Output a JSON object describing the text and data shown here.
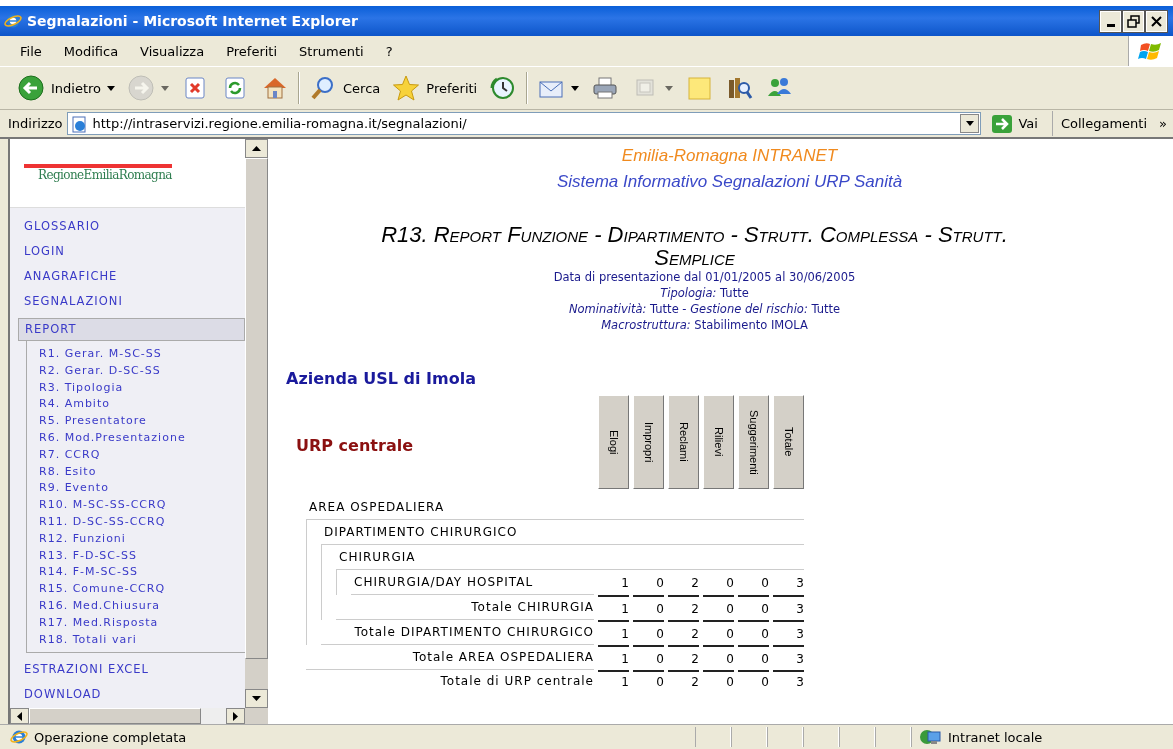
{
  "window": {
    "title": "Segnalazioni - Microsoft Internet Explorer"
  },
  "menu": [
    "File",
    "Modifica",
    "Visualizza",
    "Preferiti",
    "Strumenti",
    "?"
  ],
  "toolbar": {
    "groups": [
      [
        {
          "kind": "back",
          "label": "Indietro",
          "menu": true,
          "disabled": false
        },
        {
          "kind": "forward",
          "menu": true,
          "disabled": true
        },
        {
          "kind": "stop",
          "menu": false,
          "disabled": false
        },
        {
          "kind": "refresh",
          "menu": false,
          "disabled": false
        },
        {
          "kind": "home",
          "menu": false,
          "disabled": false
        }
      ],
      [
        {
          "kind": "search",
          "label": "Cerca",
          "menu": false,
          "disabled": false
        },
        {
          "kind": "favorites",
          "label": "Preferiti",
          "menu": false,
          "disabled": false
        },
        {
          "kind": "history",
          "menu": false,
          "disabled": false
        }
      ],
      [
        {
          "kind": "mail",
          "menu": true,
          "disabled": false
        },
        {
          "kind": "print",
          "menu": false,
          "disabled": false
        },
        {
          "kind": "edit",
          "menu": true,
          "disabled": true
        },
        {
          "kind": "notes",
          "menu": false,
          "disabled": false
        },
        {
          "kind": "research",
          "menu": false,
          "disabled": false
        },
        {
          "kind": "messenger",
          "menu": false,
          "disabled": false
        }
      ]
    ]
  },
  "address": {
    "label": "Indirizzo",
    "url": "http://intraservizi.regione.emilia-romagna.it/segnalazioni/",
    "go": "Vai",
    "links": "Collegamenti",
    "more": "»"
  },
  "sidebar": {
    "logo": "RegioneEmiliaRomagna",
    "items": [
      {
        "label": "GLOSSARIO",
        "selected": false
      },
      {
        "label": "LOGIN",
        "selected": false
      },
      {
        "label": "ANAGRAFICHE",
        "selected": false
      },
      {
        "label": "SEGNALAZIONI",
        "selected": false
      },
      {
        "label": "REPORT",
        "selected": true,
        "children": [
          {
            "label": "R1. Gerar. M-SC-SS",
            "selected": false
          },
          {
            "label": "R2. Gerar. D-SC-SS",
            "selected": false
          },
          {
            "label": "R3. Tipologia",
            "selected": false
          },
          {
            "label": "R4. Ambito",
            "selected": false
          },
          {
            "label": "R5. Presentatore",
            "selected": false
          },
          {
            "label": "R6. Mod.Presentazione",
            "selected": false
          },
          {
            "label": "R7. CCRQ",
            "selected": false
          },
          {
            "label": "R8. Esito",
            "selected": false
          },
          {
            "label": "R9. Evento",
            "selected": false
          },
          {
            "label": "R10. M-SC-SS-CCRQ",
            "selected": false
          },
          {
            "label": "R11. D-SC-SS-CCRQ",
            "selected": false
          },
          {
            "label": "R12. Funzioni",
            "selected": false
          },
          {
            "label": "R13. F-D-SC-SS",
            "selected": false
          },
          {
            "label": "R14. F-M-SC-SS",
            "selected": false
          },
          {
            "label": "R15. Comune-CCRQ",
            "selected": false
          },
          {
            "label": "R16. Med.Chiusura",
            "selected": false
          },
          {
            "label": "R17. Med.Risposta",
            "selected": false
          },
          {
            "label": "R18. Totali vari",
            "selected": false
          }
        ]
      },
      {
        "label": "ESTRAZIONI EXCEL",
        "selected": false
      },
      {
        "label": "DOWNLOAD",
        "selected": false
      }
    ]
  },
  "header": {
    "brand": "Emilia-Romagna INTRANET",
    "system": "Sistema Informativo Segnalazioni URP Sanità"
  },
  "report": {
    "title": "R13. Report Funzione - Dipartimento - Strutt. Complessa - Strutt. Semplice",
    "filters": [
      "Data di presentazione dal 01/01/2005 al 30/06/2005",
      "*Tipologia:* Tutte",
      "*Nominatività:* Tutte - *Gestione del rischio:* Tutte",
      "*Macrostruttura:* Stabilimento IMOLA"
    ],
    "azienda": "Azienda USL di Imola",
    "office": "URP centrale",
    "columns": [
      "Elogi",
      "Impropri",
      "Reclami",
      "Rilievi",
      "Suggerimenti",
      "Totale"
    ],
    "rows": [
      {
        "label": "AREA OSPEDALIERA",
        "children": [
          {
            "label": "DIPARTIMENTO CHIRURGICO",
            "children": [
              {
                "label": "CHIRURGIA",
                "children": [
                  {
                    "label": "CHIRURGIA/DAY HOSPITAL",
                    "values": [
                      "1",
                      "0",
                      "2",
                      "0",
                      "0",
                      "3"
                    ]
                  }
                ],
                "total": {
                  "label": "Totale CHIRURGIA",
                  "values": [
                    "1",
                    "0",
                    "2",
                    "0",
                    "0",
                    "3"
                  ]
                }
              }
            ],
            "total": {
              "label": "Totale DIPARTIMENTO CHIRURGICO",
              "values": [
                "1",
                "0",
                "2",
                "0",
                "0",
                "3"
              ]
            }
          }
        ],
        "total": {
          "label": "Totale AREA OSPEDALIERA",
          "values": [
            "1",
            "0",
            "2",
            "0",
            "0",
            "3"
          ]
        }
      }
    ],
    "grand_total": {
      "label": "Totale di URP centrale",
      "values": [
        "1",
        "0",
        "2",
        "0",
        "0",
        "3"
      ]
    }
  },
  "status_bar": {
    "message": "Operazione completata",
    "zone": "Intranet locale"
  }
}
